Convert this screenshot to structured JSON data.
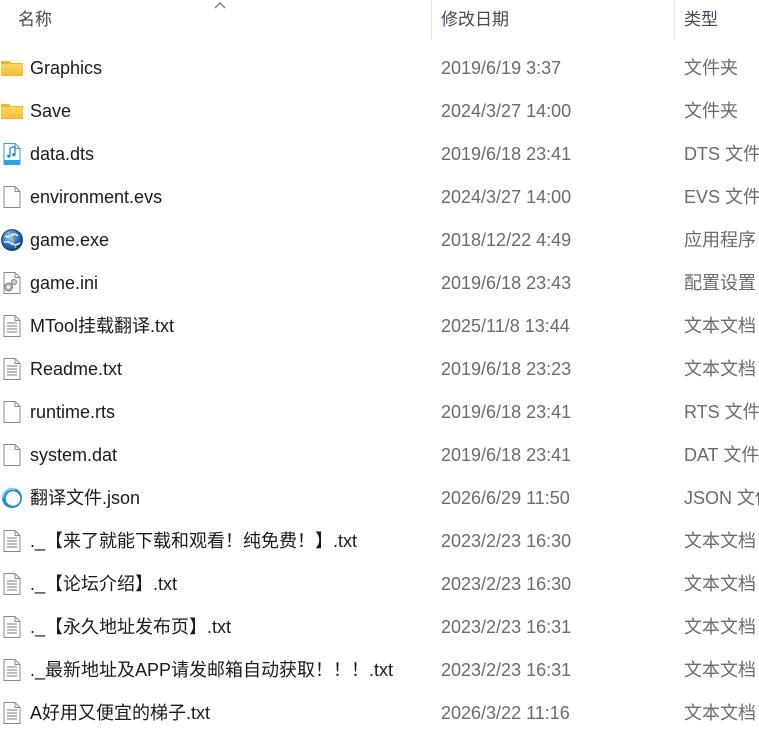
{
  "columns": {
    "name": "名称",
    "date": "修改日期",
    "type": "类型"
  },
  "files": [
    {
      "icon": "folder-icon",
      "name": "Graphics",
      "date": "2019/6/19 3:37",
      "type": "文件夹"
    },
    {
      "icon": "folder-icon",
      "name": "Save",
      "date": "2024/3/27 14:00",
      "type": "文件夹"
    },
    {
      "icon": "audio-file-icon",
      "name": "data.dts",
      "date": "2019/6/18 23:41",
      "type": "DTS 文件"
    },
    {
      "icon": "blank-file-icon",
      "name": "environment.evs",
      "date": "2024/3/27 14:00",
      "type": "EVS 文件"
    },
    {
      "icon": "app-globe-icon",
      "name": "game.exe",
      "date": "2018/12/22 4:49",
      "type": "应用程序"
    },
    {
      "icon": "settings-file-icon",
      "name": "game.ini",
      "date": "2019/6/18 23:43",
      "type": "配置设置"
    },
    {
      "icon": "text-file-icon",
      "name": "MTool挂载翻译.txt",
      "date": "2025/11/8 13:44",
      "type": "文本文档"
    },
    {
      "icon": "text-file-icon",
      "name": "Readme.txt",
      "date": "2019/6/18 23:23",
      "type": "文本文档"
    },
    {
      "icon": "blank-file-icon",
      "name": "runtime.rts",
      "date": "2019/6/18 23:41",
      "type": "RTS 文件"
    },
    {
      "icon": "blank-file-icon",
      "name": "system.dat",
      "date": "2019/6/18 23:41",
      "type": "DAT 文件"
    },
    {
      "icon": "json-file-icon",
      "name": "翻译文件.json",
      "date": "2026/6/29 11:50",
      "type": "JSON 文件"
    },
    {
      "icon": "text-file-icon",
      "name": "._【来了就能下载和观看！纯免费！】.txt",
      "date": "2023/2/23 16:30",
      "type": "文本文档"
    },
    {
      "icon": "text-file-icon",
      "name": "._【论坛介绍】.txt",
      "date": "2023/2/23 16:30",
      "type": "文本文档"
    },
    {
      "icon": "text-file-icon",
      "name": "._【永久地址发布页】.txt",
      "date": "2023/2/23 16:31",
      "type": "文本文档"
    },
    {
      "icon": "text-file-icon",
      "name": "._最新地址及APP请发邮箱自动获取！！！.txt",
      "date": "2023/2/23 16:31",
      "type": "文本文档"
    },
    {
      "icon": "text-file-icon",
      "name": "A好用又便宜的梯子.txt",
      "date": "2026/3/22 11:16",
      "type": "文本文档"
    }
  ]
}
